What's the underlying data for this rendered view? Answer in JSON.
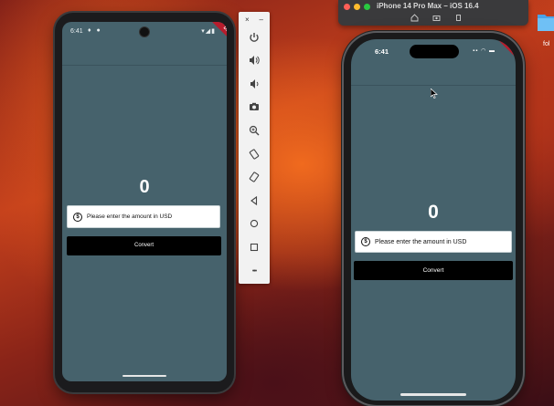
{
  "android": {
    "status": {
      "time": "6:41",
      "icons": "♦ ●",
      "right": "▾◢▮"
    },
    "debug": "DEBUG",
    "amount": "0",
    "field_placeholder": "Please enter the amount in USD",
    "convert_label": "Convert"
  },
  "toolbar": {
    "close": "×",
    "minimize": "–",
    "more": "•••"
  },
  "simulator": {
    "title": "iPhone 14 Pro Max – iOS 16.4"
  },
  "iphone": {
    "time": "6:41",
    "status_right": "▪▪ ◠ ▬",
    "debug": "DEBUG",
    "amount": "0",
    "field_placeholder": "Please enter the amount in USD",
    "convert_label": "Convert"
  },
  "desktop": {
    "folder_label": "fol"
  },
  "colors": {
    "app_background": "#46626c",
    "button": "#000000",
    "debug_banner": "#b71c2c"
  }
}
